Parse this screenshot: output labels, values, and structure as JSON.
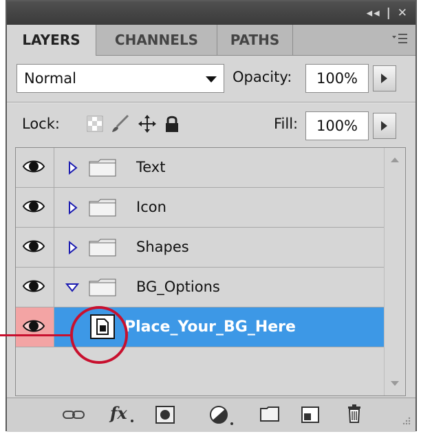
{
  "panel": {
    "title_controls": "◂◂ | ✕",
    "tabs": [
      {
        "label": "LAYERS"
      },
      {
        "label": "CHANNELS"
      },
      {
        "label": "PATHS"
      }
    ],
    "tab_menu_icon": "panel-menu-icon"
  },
  "blend": {
    "mode": "Normal",
    "opacity_label": "Opacity:",
    "opacity_value": "100%"
  },
  "lock": {
    "label": "Lock:",
    "fill_label": "Fill:",
    "fill_value": "100%"
  },
  "layers": [
    {
      "name": "Text",
      "type": "group",
      "expanded": false
    },
    {
      "name": "Icon",
      "type": "group",
      "expanded": false
    },
    {
      "name": "Shapes",
      "type": "group",
      "expanded": false
    },
    {
      "name": "BG_Options",
      "type": "group",
      "expanded": true
    },
    {
      "name": "Place_Your_BG_Here",
      "type": "smart-object",
      "selected": true
    }
  ],
  "colors": {
    "selection": "#3d98e6",
    "callout": "#c8102e",
    "eye_highlight": "#f3a4a4"
  },
  "bottom_icons": [
    "link-icon",
    "fx-icon",
    "mask-icon",
    "adjustment-icon",
    "folder-icon",
    "new-layer-icon",
    "trash-icon"
  ]
}
